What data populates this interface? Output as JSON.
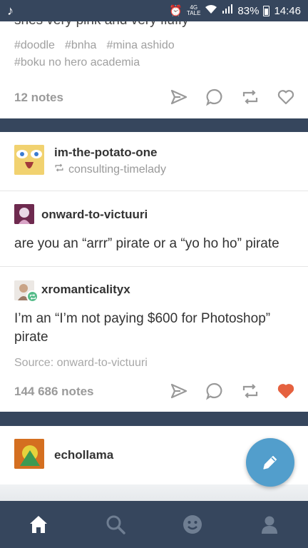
{
  "status_bar": {
    "battery": "83%",
    "time": "14:46",
    "network": "4G",
    "network_sub": "TALE"
  },
  "post1": {
    "clipped_text": "shes very pink and very fluffy",
    "tags": [
      "#doodle",
      "#bnha",
      "#mina ashido",
      "#boku no hero academia"
    ],
    "notes": "12 notes"
  },
  "post2": {
    "author": "im-the-potato-one",
    "reblogged_from": "consulting-timelady",
    "thread": [
      {
        "user": "onward-to-victuuri",
        "text": "are you an “arrr” pirate or a “yo ho ho” pirate"
      },
      {
        "user": "xromanticalityx",
        "text": "I’m an “I’m not paying $600 for Photoshop” pirate"
      }
    ],
    "source": "Source: onward-to-victuuri",
    "notes": "144 686 notes",
    "liked": true
  },
  "post3": {
    "author": "echollama"
  },
  "colors": {
    "nav": "#36465d",
    "fab": "#529ecc",
    "liked_heart": "#e5613f",
    "reblog_green": "#56bc8a"
  }
}
